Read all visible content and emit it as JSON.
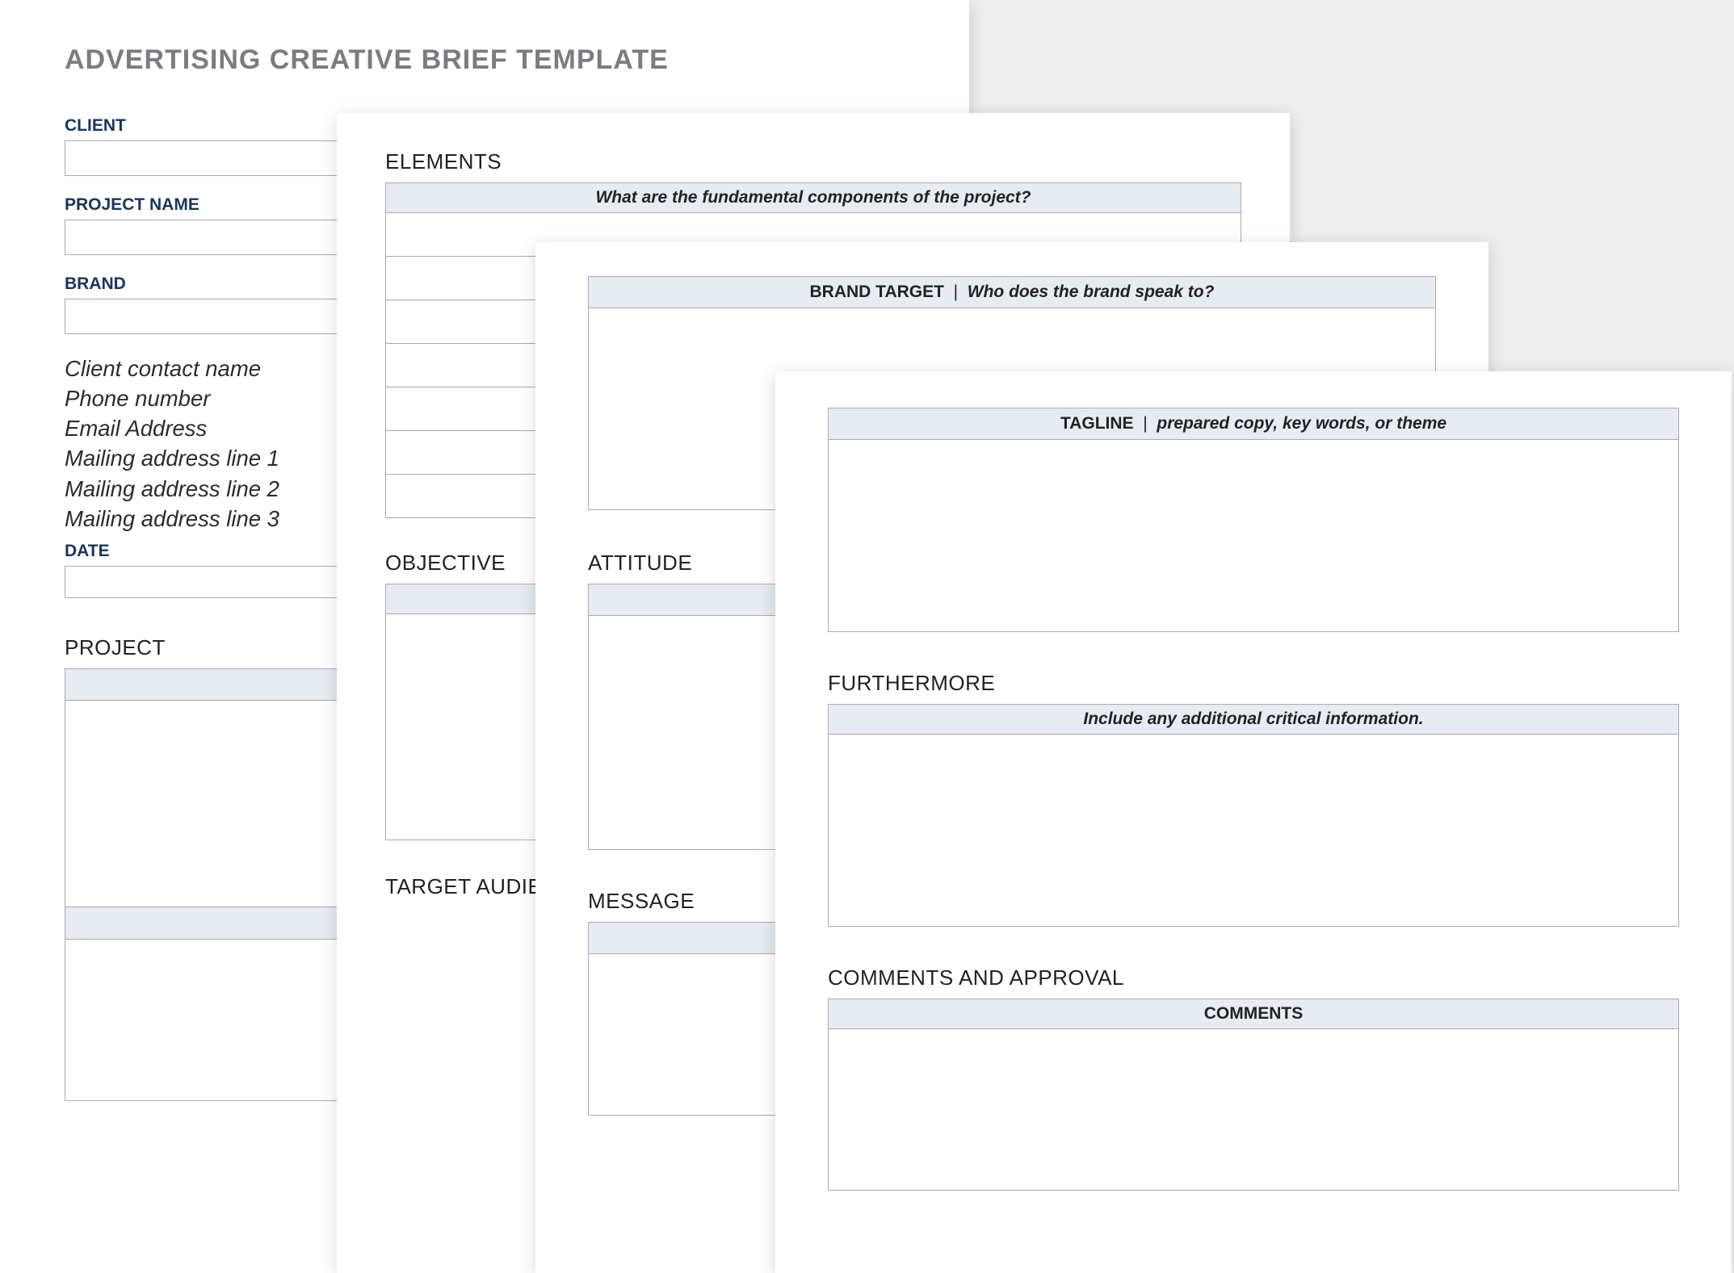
{
  "page1": {
    "title": "ADVERTISING CREATIVE BRIEF TEMPLATE",
    "client_label": "CLIENT",
    "project_name_label": "PROJECT NAME",
    "brand_label": "BRAND",
    "contact_lines": [
      "Client contact name",
      "Phone number",
      "Email Address",
      "Mailing address line 1",
      "Mailing address line 2",
      "Mailing address line 3"
    ],
    "date_label": "DATE",
    "project_section_label": "PROJECT"
  },
  "page2": {
    "elements_label": "ELEMENTS",
    "elements_header": "What are the fundamental components of the project?",
    "objective_label": "OBJECTIVE",
    "target_audience_label": "TARGET AUDIENCE"
  },
  "page3": {
    "brand_target_label": "BRAND TARGET",
    "brand_target_sub": "Who does the brand speak to?",
    "attitude_label": "ATTITUDE",
    "message_label": "MESSAGE"
  },
  "page4": {
    "tagline_label": "TAGLINE",
    "tagline_sub": "prepared copy, key words, or theme",
    "furthermore_label": "FURTHERMORE",
    "furthermore_header": "Include any additional critical information.",
    "comments_approval_label": "COMMENTS AND APPROVAL",
    "comments_header": "COMMENTS"
  }
}
